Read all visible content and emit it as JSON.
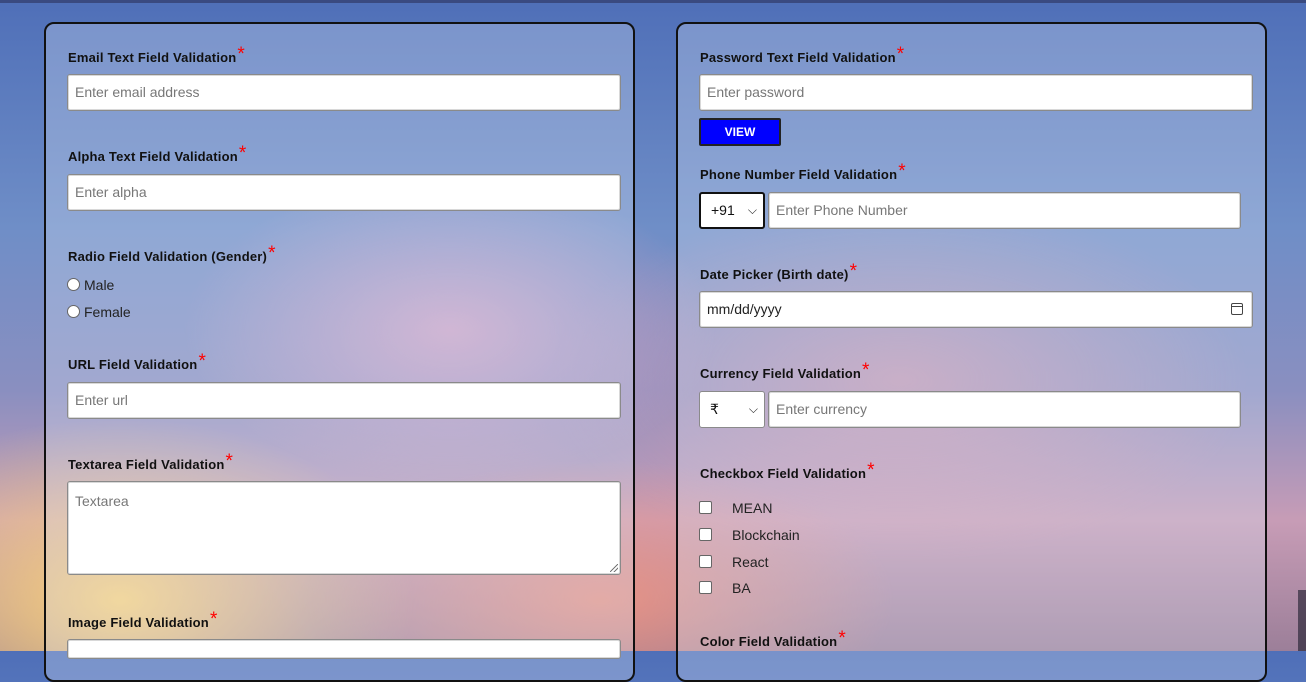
{
  "left_panel": {
    "email": {
      "label": "Email Text Field Validation",
      "placeholder": "Enter email address"
    },
    "alpha": {
      "label": "Alpha Text Field Validation",
      "placeholder": "Enter alpha"
    },
    "gender": {
      "label": "Radio Field Validation (Gender)",
      "options": [
        "Male",
        "Female"
      ]
    },
    "url": {
      "label": "URL Field Validation",
      "placeholder": "Enter url"
    },
    "textarea": {
      "label": "Textarea Field Validation",
      "placeholder": "Textarea"
    },
    "image": {
      "label": "Image Field Validation"
    }
  },
  "right_panel": {
    "password": {
      "label": "Password Text Field Validation",
      "placeholder": "Enter password",
      "view_button": "VIEW"
    },
    "phone": {
      "label": "Phone Number Field Validation",
      "country_code": "+91",
      "placeholder": "Enter Phone Number"
    },
    "birthdate": {
      "label": "Date Picker (Birth date)",
      "placeholder": "mm/dd/yyyy"
    },
    "currency": {
      "label": "Currency Field Validation",
      "symbol": "₹",
      "placeholder": "Enter currency"
    },
    "checkbox": {
      "label": "Checkbox Field Validation",
      "options": [
        "MEAN",
        "Blockchain",
        "React",
        "BA"
      ]
    },
    "color": {
      "label": "Color Field Validation"
    }
  },
  "required_marker": "*",
  "colors": {
    "accent_button": "#0000ff",
    "required": "#ff0000"
  }
}
